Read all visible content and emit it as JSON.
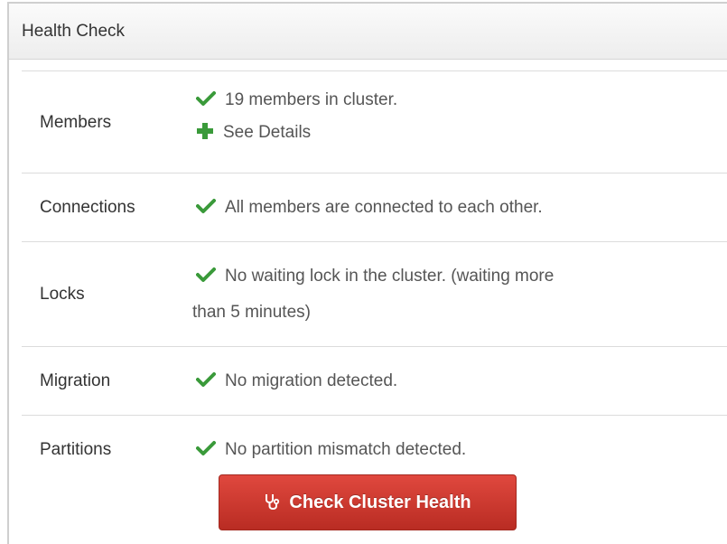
{
  "panel": {
    "title": "Health Check"
  },
  "rows": [
    {
      "label": "Members",
      "status": "19 members in cluster.",
      "link": "See Details"
    },
    {
      "label": "Connections",
      "status": "All members are connected to each other."
    },
    {
      "label": "Locks",
      "status": "No waiting lock in the cluster. (waiting more",
      "status_cont": "than 5 minutes)"
    },
    {
      "label": "Migration",
      "status": "No migration detected."
    },
    {
      "label": "Partitions",
      "status": "No partition mismatch detected."
    }
  ],
  "button": {
    "label": "Check Cluster Health",
    "icon": "stethoscope-icon"
  },
  "colors": {
    "ok": "#3a9a3a",
    "button": "#cf3a31",
    "header_bg": "#f2f2f2"
  },
  "icons": {
    "ok": "check-icon",
    "expand": "plus-icon"
  }
}
